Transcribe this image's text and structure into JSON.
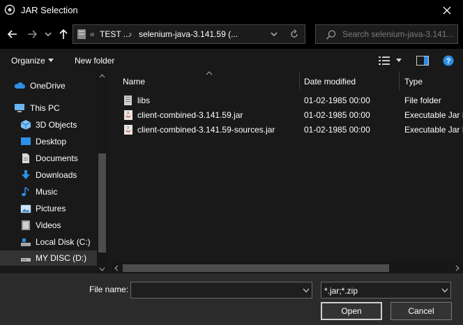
{
  "window": {
    "title": "JAR Selection"
  },
  "address": {
    "chevrons": "«",
    "segments": [
      "TEST ...",
      "selenium-java-3.141.59 (..."
    ]
  },
  "search": {
    "placeholder": "Search selenium-java-3.141..."
  },
  "toolbar": {
    "organize": "Organize",
    "new_folder": "New folder"
  },
  "nav": {
    "items": [
      {
        "label": "OneDrive",
        "icon": "cloud-icon"
      },
      {
        "label": "This PC",
        "icon": "pc-icon"
      },
      {
        "label": "3D Objects",
        "icon": "cube-icon"
      },
      {
        "label": "Desktop",
        "icon": "desktop-icon"
      },
      {
        "label": "Documents",
        "icon": "documents-icon"
      },
      {
        "label": "Downloads",
        "icon": "download-icon"
      },
      {
        "label": "Music",
        "icon": "music-icon"
      },
      {
        "label": "Pictures",
        "icon": "pictures-icon"
      },
      {
        "label": "Videos",
        "icon": "videos-icon"
      },
      {
        "label": "Local Disk (C:)",
        "icon": "drive-icon"
      },
      {
        "label": "MY DISC (D:)",
        "icon": "disc-drive-icon",
        "selected": true
      }
    ]
  },
  "columns": {
    "name": "Name",
    "date": "Date modified",
    "type": "Type"
  },
  "files": [
    {
      "name": "libs",
      "date": "01-02-1985 00:00",
      "type": "File folder",
      "icon": "folder-icon"
    },
    {
      "name": "client-combined-3.141.59.jar",
      "date": "01-02-1985 00:00",
      "type": "Executable Jar F",
      "icon": "jar-file-icon"
    },
    {
      "name": "client-combined-3.141.59-sources.jar",
      "date": "01-02-1985 00:00",
      "type": "Executable Jar F",
      "icon": "jar-file-icon"
    }
  ],
  "footer": {
    "file_name_label": "File name:",
    "file_name_value": "",
    "filter_value": "*.jar;*.zip",
    "open_label": "Open",
    "cancel_label": "Cancel"
  },
  "colors": {
    "accent": "#2d8fe6",
    "selection": "#333333"
  }
}
